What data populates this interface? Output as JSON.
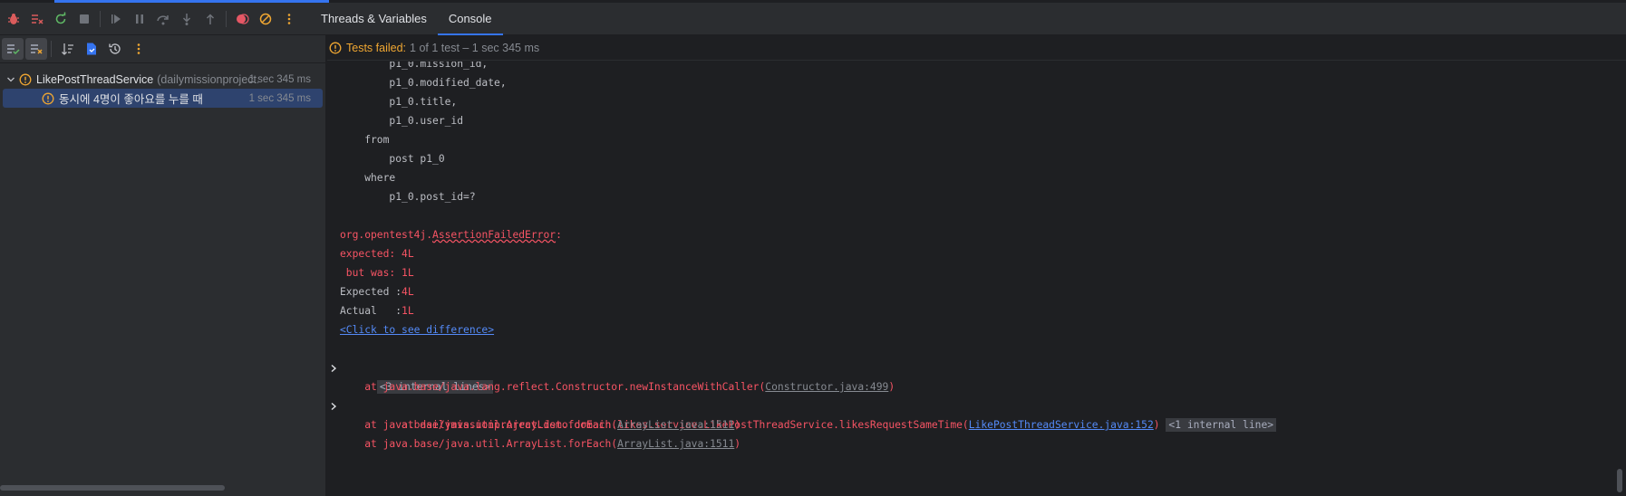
{
  "tabs": [
    {
      "label": "Threads & Variables",
      "active": false
    },
    {
      "label": "Console",
      "active": true
    }
  ],
  "status": {
    "failed_label": "Tests failed:",
    "rest": "1 of 1 test – 1 sec 345 ms"
  },
  "tree": {
    "root": {
      "name": "LikePostThreadService",
      "package": "(dailymissionproject.",
      "time": "1 sec 345 ms"
    },
    "child": {
      "name": "동시에 4명이 좋아요를 누를 때",
      "time": "1 sec 345 ms"
    }
  },
  "console": {
    "sql": [
      "        p1_0.mission_id,",
      "        p1_0.modified_date,",
      "        p1_0.title,",
      "        p1_0.user_id",
      "    from",
      "        post p1_0",
      "    where",
      "        p1_0.post_id=?"
    ],
    "error_prefix": "org.opentest4j.",
    "error_class": "AssertionFailedError",
    "error_suffix": ":",
    "expected_line": "expected: 4L",
    "but_was_line": " but was: 1L",
    "expected_label": "Expected :",
    "expected_value": "4L",
    "actual_label": "Actual   :",
    "actual_value": "1L",
    "diff_link": "<Click to see difference>",
    "internal_lines_3": "<3 internal lines>",
    "stack": [
      {
        "prefix": "    at java.base/java.lang.reflect.Constructor.newInstanceWithCaller(",
        "link": "Constructor.java:499",
        "suffix": ")",
        "fold": "",
        "style": "gray"
      },
      {
        "prefix": "    at dailymissionproject.demo.domain.likes.service.LikePostThreadService.likesRequestSameTime(",
        "link": "LikePostThreadService.java:152",
        "suffix": ")",
        "fold": "<1 internal line>",
        "style": "blue"
      },
      {
        "prefix": "    at java.base/java.util.ArrayList.forEach(",
        "link": "ArrayList.java:1511",
        "suffix": ")",
        "fold": "",
        "style": "gray"
      },
      {
        "prefix": "    at java.base/java.util.ArrayList.forEach(",
        "link": "ArrayList.java:1511",
        "suffix": ")",
        "fold": "",
        "style": "gray"
      }
    ]
  },
  "colors": {
    "accent": "#3574f0",
    "error": "#f75464",
    "warning": "#f0a732",
    "selection": "#2e436e"
  }
}
